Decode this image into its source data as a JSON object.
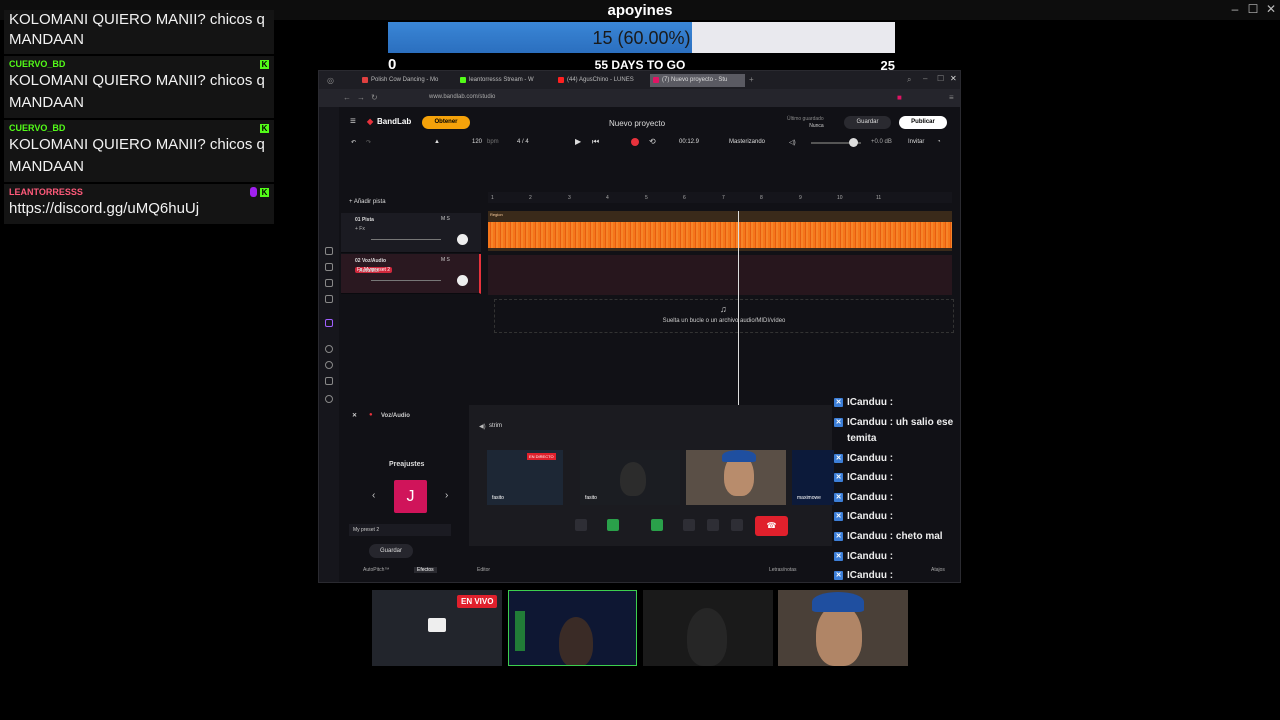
{
  "window": {
    "title": "apoyines"
  },
  "chat": [
    {
      "user": "",
      "text": "KOLOMANI QUIERO MANII? chicos q MANDAAN",
      "user_color": "#53fc18",
      "partial": true
    },
    {
      "user": "CUERVO_BD",
      "text": "KOLOMANI QUIERO MANII? chicos q MANDAAN",
      "user_color": "#53fc18"
    },
    {
      "user": "CUERVO_BD",
      "text": "KOLOMANI QUIERO MANII? chicos q MANDAAN",
      "user_color": "#53fc18"
    },
    {
      "user": "LEANTORRESSS",
      "text": "https://discord.gg/uMQ6huUj",
      "user_color": "#ff5a7a"
    }
  ],
  "goal": {
    "label": "15 (60.00%)",
    "progress": 0.6,
    "min": "0",
    "max": "25",
    "days_label": "55 DAYS TO GO",
    "fill_color": "#2f78c9"
  },
  "browser": {
    "tabs": [
      {
        "label": "Polish Cow Dancing - Mo",
        "color": "#e04040"
      },
      {
        "label": "leantorresss Stream - W",
        "color": "#53fc18"
      },
      {
        "label": "(44) AgusChino - LUNES",
        "color": "#ff2020"
      },
      {
        "label": "(7) Nuevo proyecto - Stu",
        "color": "#e01464"
      }
    ],
    "url": "www.bandlab.com/studio"
  },
  "bandlab": {
    "logo": "BandLab",
    "obtener": "Obtener",
    "project_title": "Nuevo proyecto",
    "save_info_1": "Último guardado",
    "save_info_2": "Nunca",
    "guardar": "Guardar",
    "publicar": "Publicar",
    "add_track": "+ Añadir pista",
    "bpm": "120",
    "bpm_unit": "bpm",
    "time_sig": "4 / 4",
    "time": "00:12.9",
    "mastering": "Masterizando",
    "gain": "+0.0 dB",
    "invite": "Invitar",
    "ruler": [
      "1",
      "2",
      "3",
      "4",
      "5",
      "6",
      "7",
      "8",
      "9",
      "10",
      "11"
    ],
    "tracks": [
      {
        "name": "01  Pista",
        "fx": "+ Fx",
        "fx_pink": false
      },
      {
        "name": "02  Voz/Audio",
        "fx": "Fx  My preset 2",
        "fx_pink": true
      }
    ],
    "ms": "M   S",
    "region_label": "Region",
    "automix": "AutoMix",
    "drop_text": "Suelta un bucle o un archivo audio/MIDI/vídeo",
    "voz_label": "Voz/Audio",
    "presets_title": "Preajustes",
    "preset_letter": "J",
    "preset_name": "My preset 2",
    "preset_save": "Guardar",
    "footer": {
      "autopitch": "AutoPitch™",
      "effects": "Efectos",
      "editor": "Editor",
      "lyrics": "Letras/notas",
      "shortcuts": "Atajos"
    }
  },
  "call": {
    "channel": "strim",
    "live_badge": "EN DIRECTO",
    "participants": [
      "fasito",
      "fasito",
      "",
      "maximowe"
    ]
  },
  "side_chat": [
    {
      "user": "ICanduu",
      "text": ""
    },
    {
      "user": "ICanduu",
      "text": "uh salio ese temita",
      "wrap": true
    },
    {
      "user": "ICanduu",
      "text": ""
    },
    {
      "user": "ICanduu",
      "text": ""
    },
    {
      "user": "ICanduu",
      "text": ""
    },
    {
      "user": "ICanduu",
      "text": ""
    },
    {
      "user": "ICanduu",
      "text": "cheto mal"
    },
    {
      "user": "ICanduu",
      "text": ""
    },
    {
      "user": "ICanduu",
      "text": ""
    }
  ],
  "bottom": {
    "live_badge": "EN VIVO"
  }
}
